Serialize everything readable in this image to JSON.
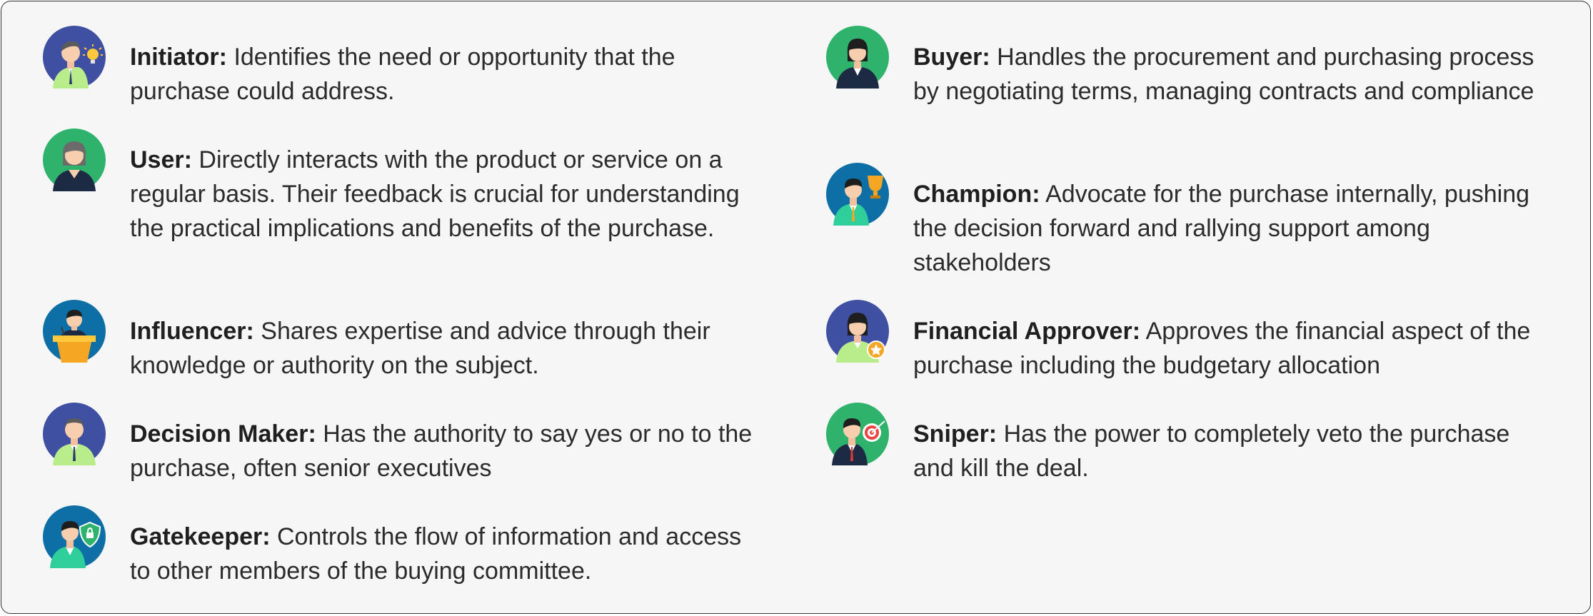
{
  "roles": [
    {
      "name": "Initiator:",
      "desc": "Identifies the need or opportunity that the purchase could address.",
      "icon": "initiator-lightbulb-avatar-icon",
      "bg": "#3f4fa2"
    },
    {
      "name": "User:",
      "desc": "Directly interacts with the product or service on a regular basis. Their feedback is crucial for understanding the practical implications and benefits of the purchase.",
      "icon": "user-woman-avatar-icon",
      "bg": "#2fb26c"
    },
    {
      "name": "Influencer:",
      "desc": "Shares expertise and advice through their knowledge or authority on the subject.",
      "icon": "influencer-podium-avatar-icon",
      "bg": "#0e6fa6"
    },
    {
      "name": "Decision Maker:",
      "desc": "Has the authority to say yes or no to the purchase, often senior executives",
      "icon": "decision-maker-avatar-icon",
      "bg": "#3f4fa2"
    },
    {
      "name": "Gatekeeper:",
      "desc": "Controls the flow of information and access to other members of the buying committee.",
      "icon": "gatekeeper-shield-avatar-icon",
      "bg": "#0e6fa6"
    },
    {
      "name": "Buyer:",
      "desc": "Handles the procurement and purchasing process by negotiating terms, managing contracts and compliance",
      "icon": "buyer-woman-avatar-icon",
      "bg": "#2fb26c"
    },
    {
      "name": "Champion:",
      "desc": "Advocate for the purchase internally, pushing the decision forward and rallying support among stakeholders",
      "icon": "champion-trophy-avatar-icon",
      "bg": "#0e6fa6"
    },
    {
      "name": "Financial Approver:",
      "desc": "Approves the financial aspect of the purchase including the budgetary allocation",
      "icon": "financial-approver-star-avatar-icon",
      "bg": "#3f4fa2"
    },
    {
      "name": "Sniper:",
      "desc": "Has the power to completely veto the purchase and kill the deal.",
      "icon": "sniper-target-avatar-icon",
      "bg": "#2fb26c"
    }
  ]
}
